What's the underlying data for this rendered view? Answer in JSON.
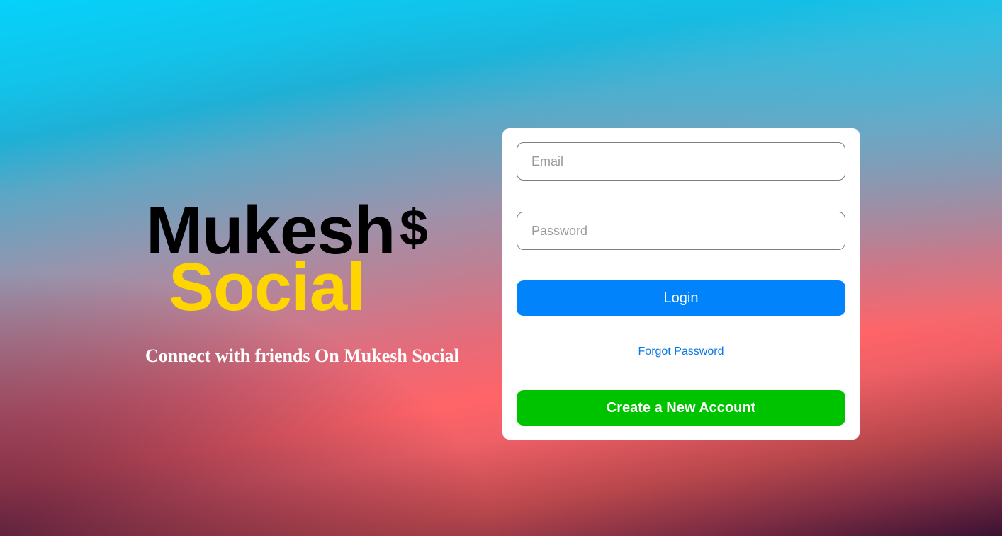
{
  "brand": {
    "name_line1": "Mukesh",
    "name_symbol": "$",
    "name_line2": "Social",
    "tagline": "Connect with friends On Mukesh Social"
  },
  "login_form": {
    "email_placeholder": "Email",
    "password_placeholder": "Password",
    "login_label": "Login",
    "forgot_label": "Forgot Password",
    "create_account_label": "Create a New Account"
  },
  "colors": {
    "login_button": "#0184fb",
    "create_button": "#00c300",
    "brand_primary": "#000000",
    "brand_secondary": "#ffd500",
    "link": "#0a79e6"
  }
}
